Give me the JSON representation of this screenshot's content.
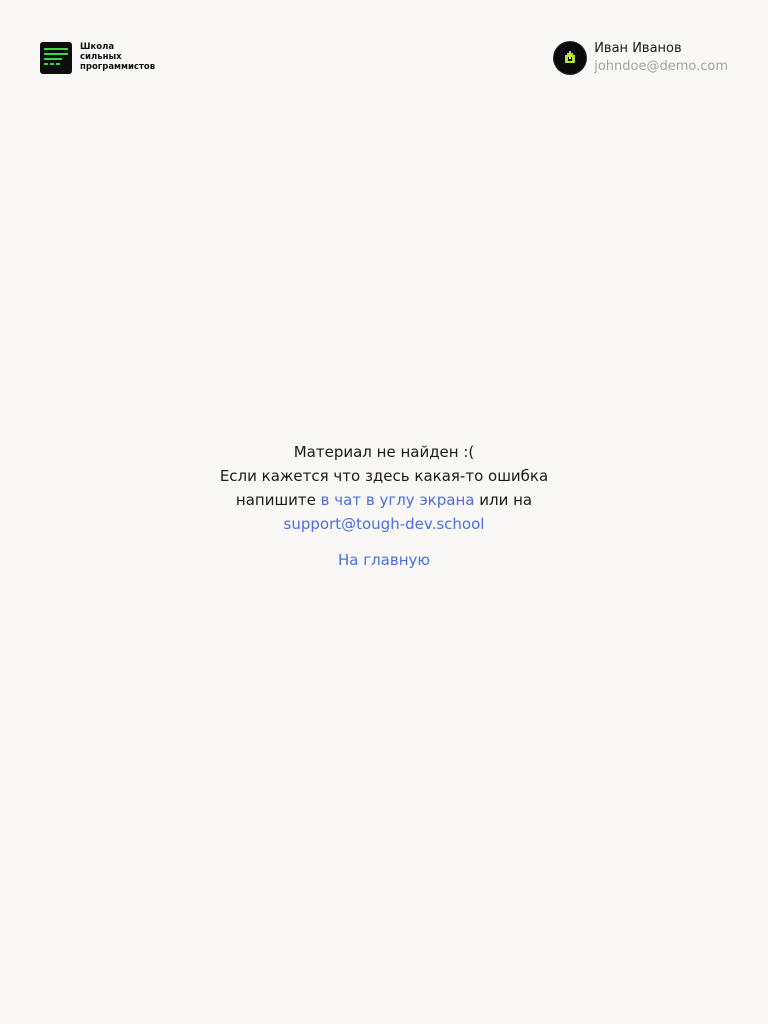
{
  "header": {
    "logo": {
      "lines": [
        "Школа",
        "сильных",
        "программистов"
      ],
      "accent_color": "#3ed63e",
      "icon": "terminal-lines-icon"
    },
    "user": {
      "name": "Иван Иванов",
      "email": "johndoe@demo.com",
      "avatar_icon": "pixel-house-avatar-icon"
    }
  },
  "main": {
    "title": "Материал не найден :(",
    "text_before": "Если кажется что здесь какая-то ошибка напишите",
    "chat_link_label": "в чат в углу экрана",
    "text_middle": "или на",
    "support_email": "support@tough-dev.school",
    "home_link_label": "На главную"
  },
  "colors": {
    "background": "#f9f8f6",
    "link": "#4a6ee0",
    "muted_text": "#a3a3a3"
  }
}
